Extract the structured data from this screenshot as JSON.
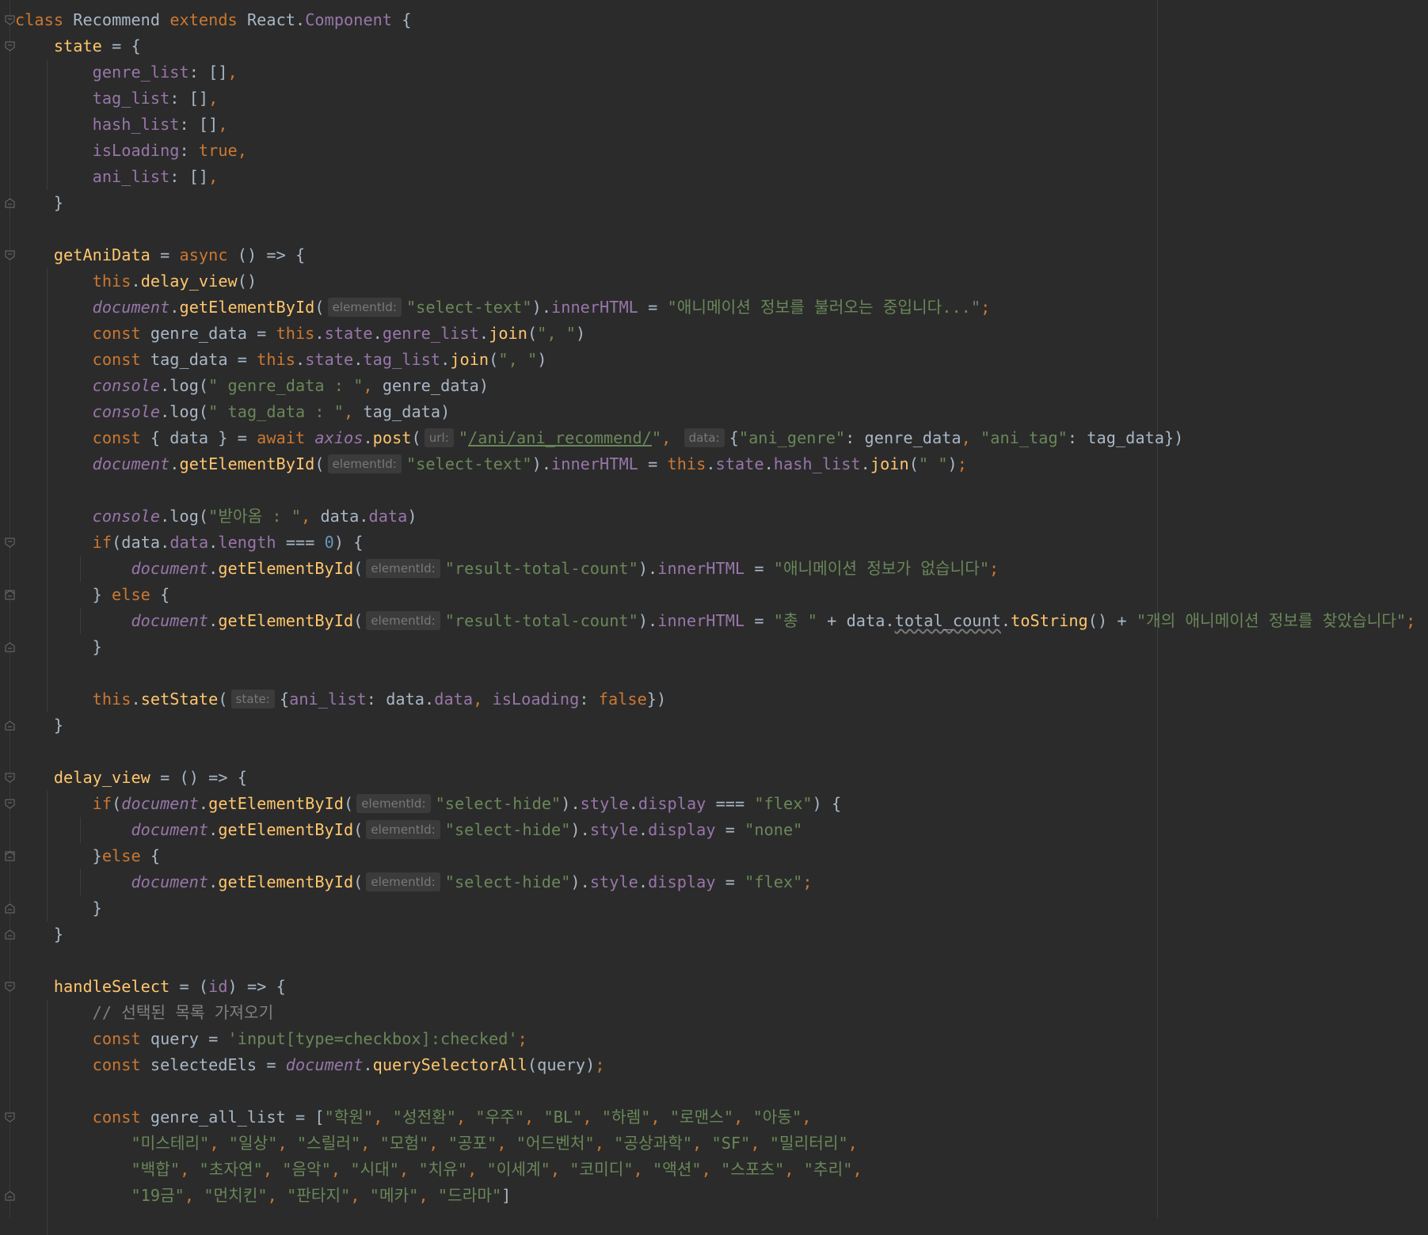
{
  "editor": {
    "theme": "darcula",
    "colors": {
      "background": "#2b2b2b",
      "keyword": "#cc7832",
      "function": "#ffc66d",
      "property": "#9876aa",
      "string": "#6a8759",
      "number": "#6897bb",
      "comment": "#808080",
      "text": "#a9b7c6"
    },
    "hint_labels": {
      "elementId": "elementId:",
      "url": "url:",
      "data": "data:",
      "state": "state:"
    },
    "code_lines": [
      "class Recommend extends React.Component {",
      "    state = {",
      "        genre_list: [],",
      "        tag_list: [],",
      "        hash_list: [],",
      "        isLoading: true,",
      "        ani_list: [],",
      "    }",
      "",
      "    getAniData = async () => {",
      "        this.delay_view()",
      "        document.getElementById(\"select-text\").innerHTML = \"애니메이션 정보를 불러오는 중입니다...\";",
      "        const genre_data = this.state.genre_list.join(\", \")",
      "        const tag_data = this.state.tag_list.join(\", \")",
      "        console.log(\" genre_data : \", genre_data)",
      "        console.log(\" tag_data : \", tag_data)",
      "        const { data } = await axios.post(\"/ani/ani_recommend/\", {\"ani_genre\": genre_data, \"ani_tag\": tag_data})",
      "        document.getElementById(\"select-text\").innerHTML = this.state.hash_list.join(\" \");",
      "",
      "        console.log(\"받아옴 : \", data.data)",
      "        if(data.data.length === 0) {",
      "            document.getElementById(\"result-total-count\").innerHTML = \"애니메이션 정보가 없습니다\";",
      "        } else {",
      "            document.getElementById(\"result-total-count\").innerHTML = \"총 \" + data.total_count.toString() + \"개의 애니메이션 정보를 찾았습니다\";",
      "        }",
      "",
      "        this.setState({ani_list: data.data, isLoading: false})",
      "    }",
      "",
      "    delay_view = () => {",
      "        if(document.getElementById(\"select-hide\").style.display === \"flex\") {",
      "            document.getElementById(\"select-hide\").style.display = \"none\"",
      "        }else {",
      "            document.getElementById(\"select-hide\").style.display = \"flex\";",
      "        }",
      "    }",
      "",
      "    handleSelect = (id) => {",
      "        // 선택된 목록 가져오기",
      "        const query = 'input[type=checkbox]:checked';",
      "        const selectedEls = document.querySelectorAll(query);",
      "",
      "        const genre_all_list = [\"학원\", \"성전환\", \"우주\", \"BL\", \"하렘\", \"로맨스\", \"아동\",",
      "            \"미스테리\", \"일상\", \"스릴러\", \"모험\", \"공포\", \"어드벤처\", \"공상과학\", \"SF\", \"밀리터리\",",
      "            \"백합\", \"초자연\", \"음악\", \"시대\", \"치유\", \"이세계\", \"코미디\", \"액션\", \"스포츠\", \"추리\",",
      "            \"19금\", \"먼치킨\", \"판타지\", \"메카\", \"드라마\"]"
    ]
  }
}
